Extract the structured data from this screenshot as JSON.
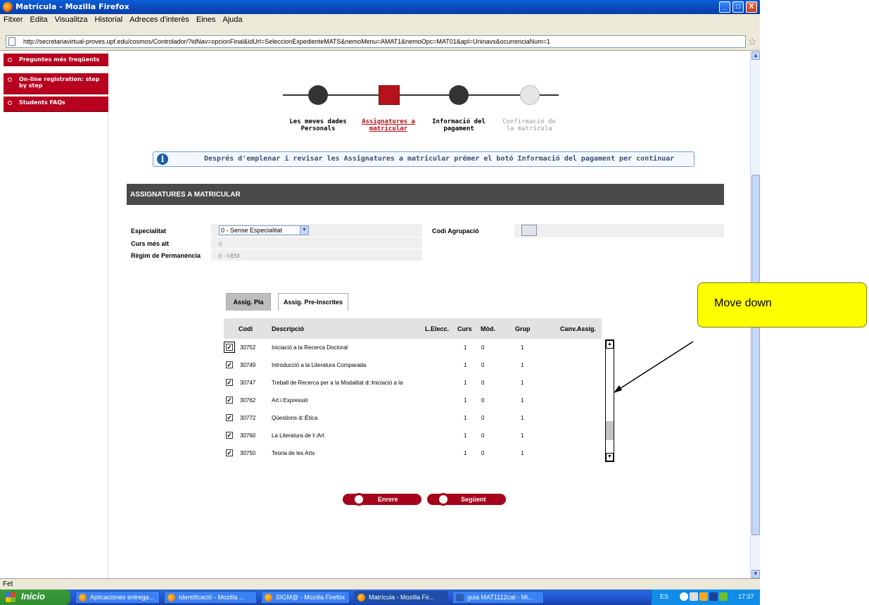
{
  "window": {
    "title": "Matrícula - Mozilla Firefox",
    "buttons": {
      "minimize": "_",
      "maximize": "□",
      "close": "X"
    }
  },
  "menu": [
    "Fitxer",
    "Edita",
    "Visualitza",
    "Historial",
    "Adreces d'interès",
    "Eines",
    "Ajuda"
  ],
  "address_bar": {
    "url": "http://secretariavirtual-proves.upf.edu/cosmos/Controlador/?idNav=opcionFinal&idUrl=SeleccionExpedienteMATS&nemoMenu=AMAT1&nemoOpc=MAT01&apl=Uninavs&ocurrenciaNum=1"
  },
  "sidebar": {
    "items": [
      {
        "label": "Preguntes més freqüents"
      },
      {
        "label": "On-line registration: step by step"
      },
      {
        "label": "Students FAQs"
      }
    ]
  },
  "steps": [
    {
      "label": "Les meves dades Personals",
      "state": "done"
    },
    {
      "label": "Assignatures a matricular",
      "state": "active"
    },
    {
      "label": "Informació del pagament",
      "state": "pending"
    },
    {
      "label": "Confirmació de la matrícula",
      "state": "disabled"
    }
  ],
  "info": {
    "text": "Després d'emplenar i revisar les Assignatures a matricular prémer el botó Informació del pagament per continuar"
  },
  "section": {
    "title": "ASSIGNATURES A MATRICULAR"
  },
  "form": {
    "especialitat_label": "Especialitat",
    "especialitat_value": "0 - Sense Especialitat",
    "curs_label": "Curs més alt",
    "curs_value": "0",
    "regim_label": "Règim de Permanència",
    "regim_value": "0 - UEM",
    "codi_agrupacio_label": "Codi Agrupació"
  },
  "tabs": [
    {
      "label": "Assig. Pla",
      "selected": true
    },
    {
      "label": "Assig. Pre-Inscrites",
      "selected": false
    }
  ],
  "table": {
    "headers": [
      "Codi",
      "Descripció",
      "L.Elecc.",
      "Curs",
      "Mòd.",
      "Grup",
      "Canv.Assig."
    ],
    "rows": [
      {
        "checked": true,
        "codi": "30752",
        "descripcio": "Iniciació a la Recerca Doctoral",
        "curs": "1",
        "mod": "0",
        "grup": "1"
      },
      {
        "checked": true,
        "codi": "30749",
        "descripcio": "Introducció a la Literatura Comparada",
        "curs": "1",
        "mod": "0",
        "grup": "1"
      },
      {
        "checked": true,
        "codi": "30747",
        "descripcio": "Treball de Recerca per a la Modalitat d□Iniciació a la",
        "curs": "1",
        "mod": "0",
        "grup": "1"
      },
      {
        "checked": true,
        "codi": "30762",
        "descripcio": "Art i Expressió",
        "curs": "1",
        "mod": "0",
        "grup": "1"
      },
      {
        "checked": true,
        "codi": "30772",
        "descripcio": "Qüestions d□Ètica",
        "curs": "1",
        "mod": "0",
        "grup": "1"
      },
      {
        "checked": true,
        "codi": "30760",
        "descripcio": "La Literatura de l□Art",
        "curs": "1",
        "mod": "0",
        "grup": "1"
      },
      {
        "checked": true,
        "codi": "30750",
        "descripcio": "Teoria de les Arts",
        "curs": "1",
        "mod": "0",
        "grup": "1"
      }
    ],
    "scroll_position": 0.85
  },
  "buttons": {
    "back": "Enrere",
    "next": "Següent"
  },
  "callout": {
    "text": "Move down"
  },
  "status": {
    "text": "Fet"
  },
  "taskbar": {
    "start": "Inicio",
    "tasks": [
      {
        "label": "Aplicaciones entrega..."
      },
      {
        "label": "Identificació - Mozilla ..."
      },
      {
        "label": "SIGM@ - Mozilla Firefox"
      },
      {
        "label": "Matrícula - Mozilla Fir..."
      },
      {
        "label": "guia MAT1112cat - Mi..."
      }
    ],
    "lang": "ES",
    "clock": "17:37"
  },
  "colors": {
    "accent": "#b5121b",
    "header": "#4a4a4a",
    "callout": "#ffff00",
    "link": "#3b5172"
  }
}
